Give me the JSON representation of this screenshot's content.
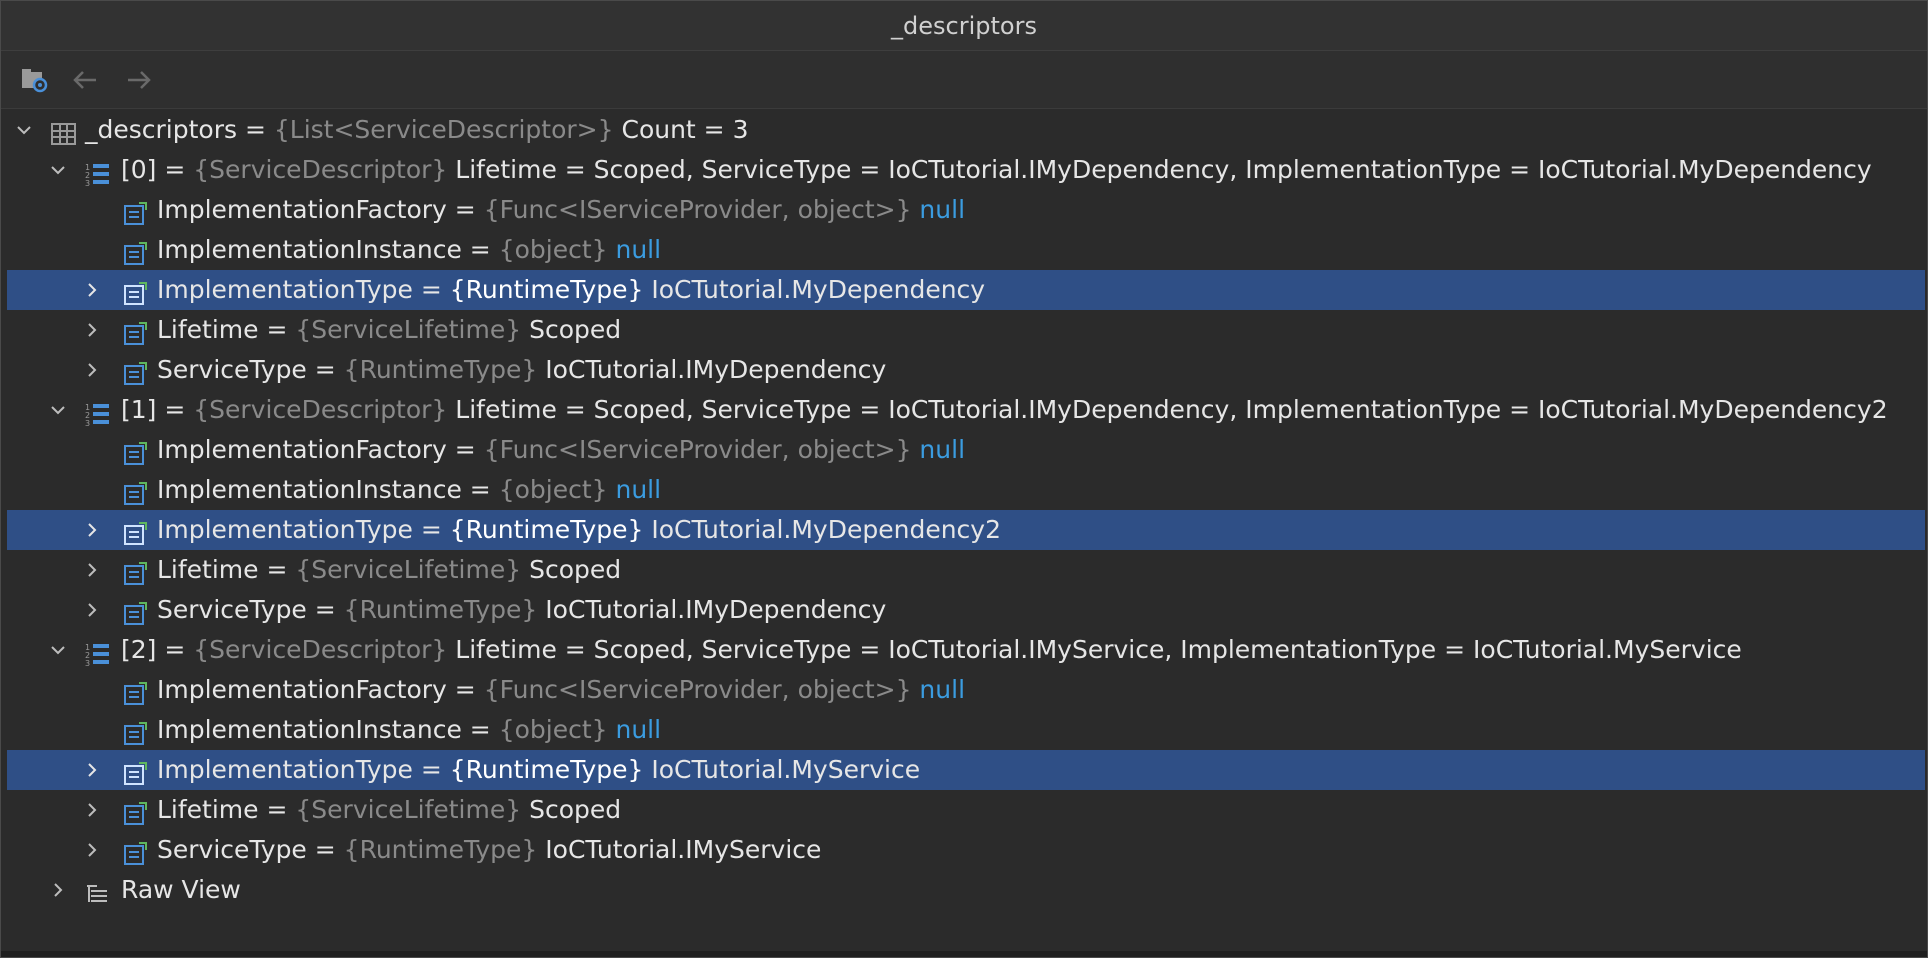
{
  "window": {
    "title": "_descriptors"
  },
  "toolbar": {
    "buttons": [
      {
        "name": "evaluate-expression-icon"
      },
      {
        "name": "back-arrow-icon"
      },
      {
        "name": "forward-arrow-icon"
      }
    ]
  },
  "tree": {
    "root": {
      "name": "_descriptors = ",
      "type": "{List<ServiceDescriptor>}",
      "value": " Count = 3"
    },
    "items": [
      {
        "header": {
          "name": "[0] = ",
          "type": "{ServiceDescriptor}",
          "value": " Lifetime = Scoped, ServiceType = IoCTutorial.IMyDependency, ImplementationType = IoCTutorial.MyDependency"
        },
        "children": [
          {
            "name": "ImplementationFactory = ",
            "type": "{Func<IServiceProvider, object>}",
            "value": " null",
            "is_null": true
          },
          {
            "name": "ImplementationInstance = ",
            "type": "{object}",
            "value": " null",
            "is_null": true
          },
          {
            "name": "ImplementationType = ",
            "type": "{RuntimeType}",
            "value": " IoCTutorial.MyDependency"
          },
          {
            "name": "Lifetime = ",
            "type": "{ServiceLifetime}",
            "value": " Scoped"
          },
          {
            "name": "ServiceType = ",
            "type": "{RuntimeType}",
            "value": " IoCTutorial.IMyDependency"
          }
        ]
      },
      {
        "header": {
          "name": "[1] = ",
          "type": "{ServiceDescriptor}",
          "value": " Lifetime = Scoped, ServiceType = IoCTutorial.IMyDependency, ImplementationType = IoCTutorial.MyDependency2"
        },
        "children": [
          {
            "name": "ImplementationFactory = ",
            "type": "{Func<IServiceProvider, object>}",
            "value": " null",
            "is_null": true
          },
          {
            "name": "ImplementationInstance = ",
            "type": "{object}",
            "value": " null",
            "is_null": true
          },
          {
            "name": "ImplementationType = ",
            "type": "{RuntimeType}",
            "value": " IoCTutorial.MyDependency2"
          },
          {
            "name": "Lifetime = ",
            "type": "{ServiceLifetime}",
            "value": " Scoped"
          },
          {
            "name": "ServiceType = ",
            "type": "{RuntimeType}",
            "value": " IoCTutorial.IMyDependency"
          }
        ]
      },
      {
        "header": {
          "name": "[2] = ",
          "type": "{ServiceDescriptor}",
          "value": " Lifetime = Scoped, ServiceType = IoCTutorial.IMyService, ImplementationType = IoCTutorial.MyService"
        },
        "children": [
          {
            "name": "ImplementationFactory = ",
            "type": "{Func<IServiceProvider, object>}",
            "value": " null",
            "is_null": true
          },
          {
            "name": "ImplementationInstance = ",
            "type": "{object}",
            "value": " null",
            "is_null": true
          },
          {
            "name": "ImplementationType = ",
            "type": "{RuntimeType}",
            "value": " IoCTutorial.MyService"
          },
          {
            "name": "Lifetime = ",
            "type": "{ServiceLifetime}",
            "value": " Scoped"
          },
          {
            "name": "ServiceType = ",
            "type": "{RuntimeType}",
            "value": " IoCTutorial.IMyService"
          }
        ]
      }
    ],
    "raw_view": {
      "label": "Raw View"
    }
  },
  "colors": {
    "background": "#2b2b2b",
    "selection": "#2f4f86",
    "type_text": "#8a8a8a",
    "null_text": "#3b9ce0",
    "icon_blue": "#4a90d9",
    "icon_green": "#5fb85f"
  }
}
